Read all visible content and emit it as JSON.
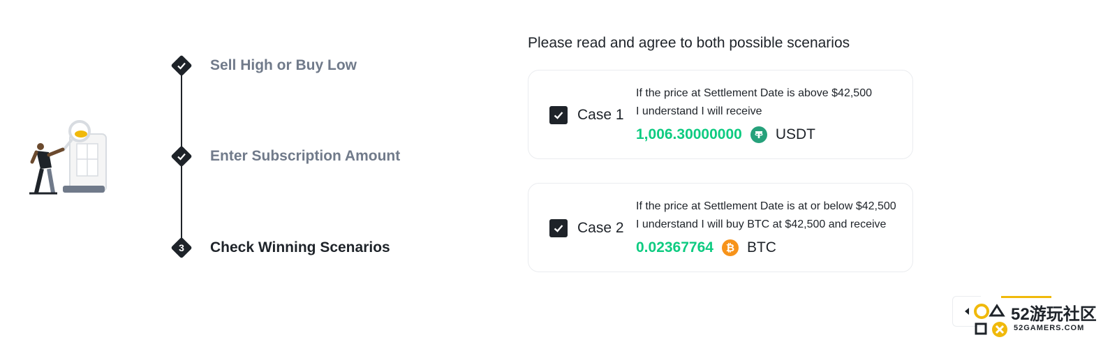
{
  "steps": [
    {
      "label": "Sell High or Buy Low",
      "state": "completed",
      "icon": "check-icon"
    },
    {
      "label": "Enter Subscription Amount",
      "state": "completed",
      "icon": "check-icon"
    },
    {
      "label": "Check Winning Scenarios",
      "state": "active",
      "number": "3"
    }
  ],
  "scenarios": {
    "heading": "Please read and agree to both possible scenarios",
    "cases": [
      {
        "label": "Case 1",
        "checked": true,
        "condition": "If the price at Settlement Date is above $42,500",
        "outcome": "I understand I will receive",
        "amount": "1,006.30000000",
        "coin": "USDT",
        "coin_icon": "tether-icon"
      },
      {
        "label": "Case 2",
        "checked": true,
        "condition": "If the price at Settlement Date is at or below $42,500",
        "outcome": "I understand I will buy  BTC  at  $42,500  and receive",
        "amount": "0.02367764",
        "coin": "BTC",
        "coin_icon": "bitcoin-icon"
      }
    ]
  },
  "watermark": {
    "title": "52游玩社区",
    "subtitle": "52GAMERS.COM"
  },
  "colors": {
    "text": "#1e2329",
    "muted": "#707a8a",
    "positive": "#0ecb81",
    "usdt": "#26a17b",
    "btc": "#f7931a",
    "accent": "#f0b90b"
  }
}
